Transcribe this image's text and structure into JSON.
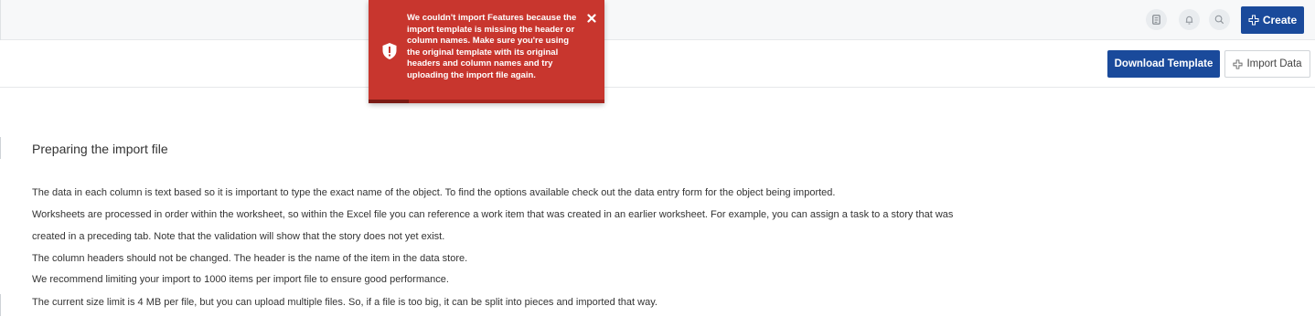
{
  "header": {
    "create_label": "Create",
    "icons": [
      "report-icon",
      "bell-icon",
      "search-icon",
      "plus-icon"
    ]
  },
  "toolbar": {
    "download_label": "Download Template",
    "import_label": "Import Data"
  },
  "toast": {
    "message": "We couldn't import Features because the import template is missing the header or column names. Make sure you're using the original template with its original headers and column names and try uploading the import file again.",
    "progress": 0.17,
    "background": "#c8362e"
  },
  "main": {
    "heading": "Preparing the import file",
    "paragraphs": [
      "The data in each column is text based so it is important to type the exact name of the object. To find the options available check out the data entry form for the object being imported.",
      "Worksheets are processed in order within the worksheet, so within the Excel file you can reference a work item that was created in an earlier worksheet. For example, you can assign a task to a story that was",
      "created in a preceding tab. Note that the validation will show that the story does not yet exist.",
      "The column headers should not be changed. The header is the name of the item in the data store.",
      "We recommend limiting your import to 1000 items per import file to ensure good performance.",
      "The current size limit is 4 MB per file, but you can upload multiple files. So, if a file is too big, it can be split into pieces and imported that way."
    ]
  },
  "colors": {
    "primary": "#1a4a9b",
    "error": "#c8362e"
  }
}
